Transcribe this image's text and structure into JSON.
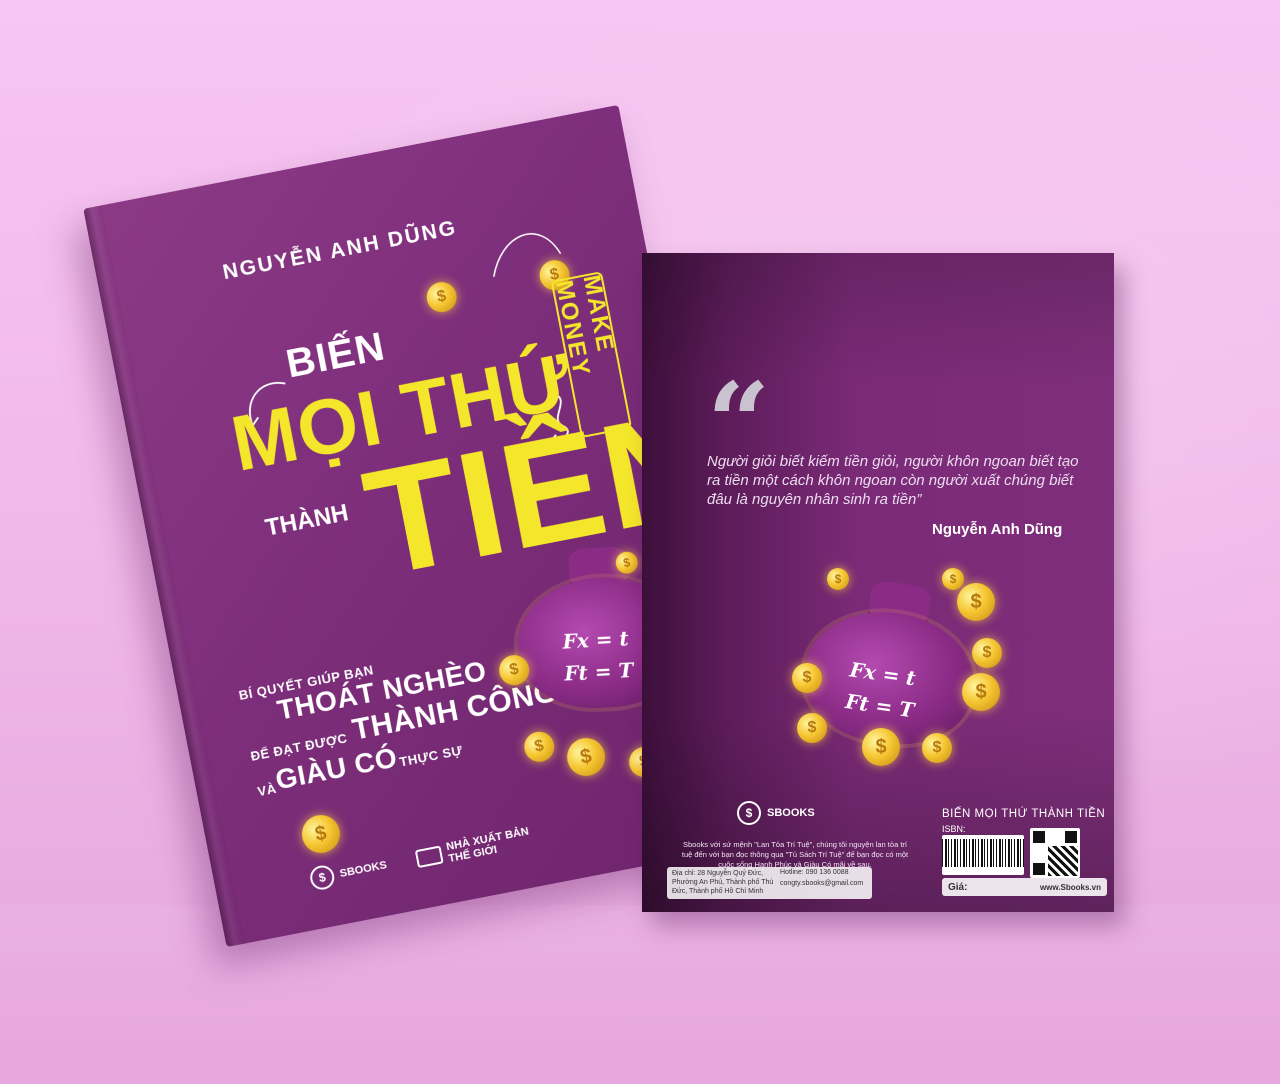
{
  "front": {
    "author": "NGUYỄN ANH DŨNG",
    "title_line1": "BIẾN",
    "title_line2": "MỌI THỨ",
    "title_small": "THÀNH",
    "title_big": "TIỀN",
    "side_tag": "MAKE MONEY",
    "tagline_1": "BÍ QUYẾT GIÚP BẠN",
    "tagline_2": "THOÁT NGHÈO",
    "tagline_3": "ĐỂ ĐẠT ĐƯỢC",
    "tagline_4": "THÀNH CÔNG",
    "tagline_5": "VÀ",
    "tagline_6": "GIÀU CÓ",
    "tagline_7": "THỰC SỰ",
    "formula_1": "Fx = t",
    "formula_2": "Ft = T",
    "logo_1": "SBOOKS",
    "publisher_line1": "NHÀ XUẤT BẢN",
    "publisher_line2": "THẾ GIỚI",
    "coin_symbol": "$"
  },
  "back": {
    "quote_mark": "“",
    "quote": "Người giỏi biết kiếm tiền giỏi, người khôn ngoan biết tạo ra tiền một cách khôn ngoan còn người xuất chúng biết đâu là nguyên nhân sinh ra tiền”",
    "quote_author": "Nguyễn Anh Dũng",
    "formula_1": "Fx = t",
    "formula_2": "Ft = T",
    "logo": "SBOOKS",
    "book_title": "BIẾN MỌI THỨ THÀNH TIỀN",
    "isbn_label": "ISBN:",
    "mission": "Sbooks với sứ mệnh \"Lan Tỏa Trí Tuệ\", chúng tôi nguyện lan tỏa trí tuệ đến với bạn đọc thông qua \"Tủ Sách Trí Tuệ\" để bạn đọc có một cuộc sống Hạnh Phúc và Giàu Có mãi về sau.",
    "address": "Địa chỉ: 28 Nguyễn Quý Đức, Phường An Phú, Thành phố Thủ Đức, Thành phố Hồ Chí Minh",
    "hotline": "Hotline: 090 136 0088",
    "email": "congty.sbooks@gmail.com",
    "price_label": "Giá:",
    "website": "www.Sbooks.vn"
  }
}
